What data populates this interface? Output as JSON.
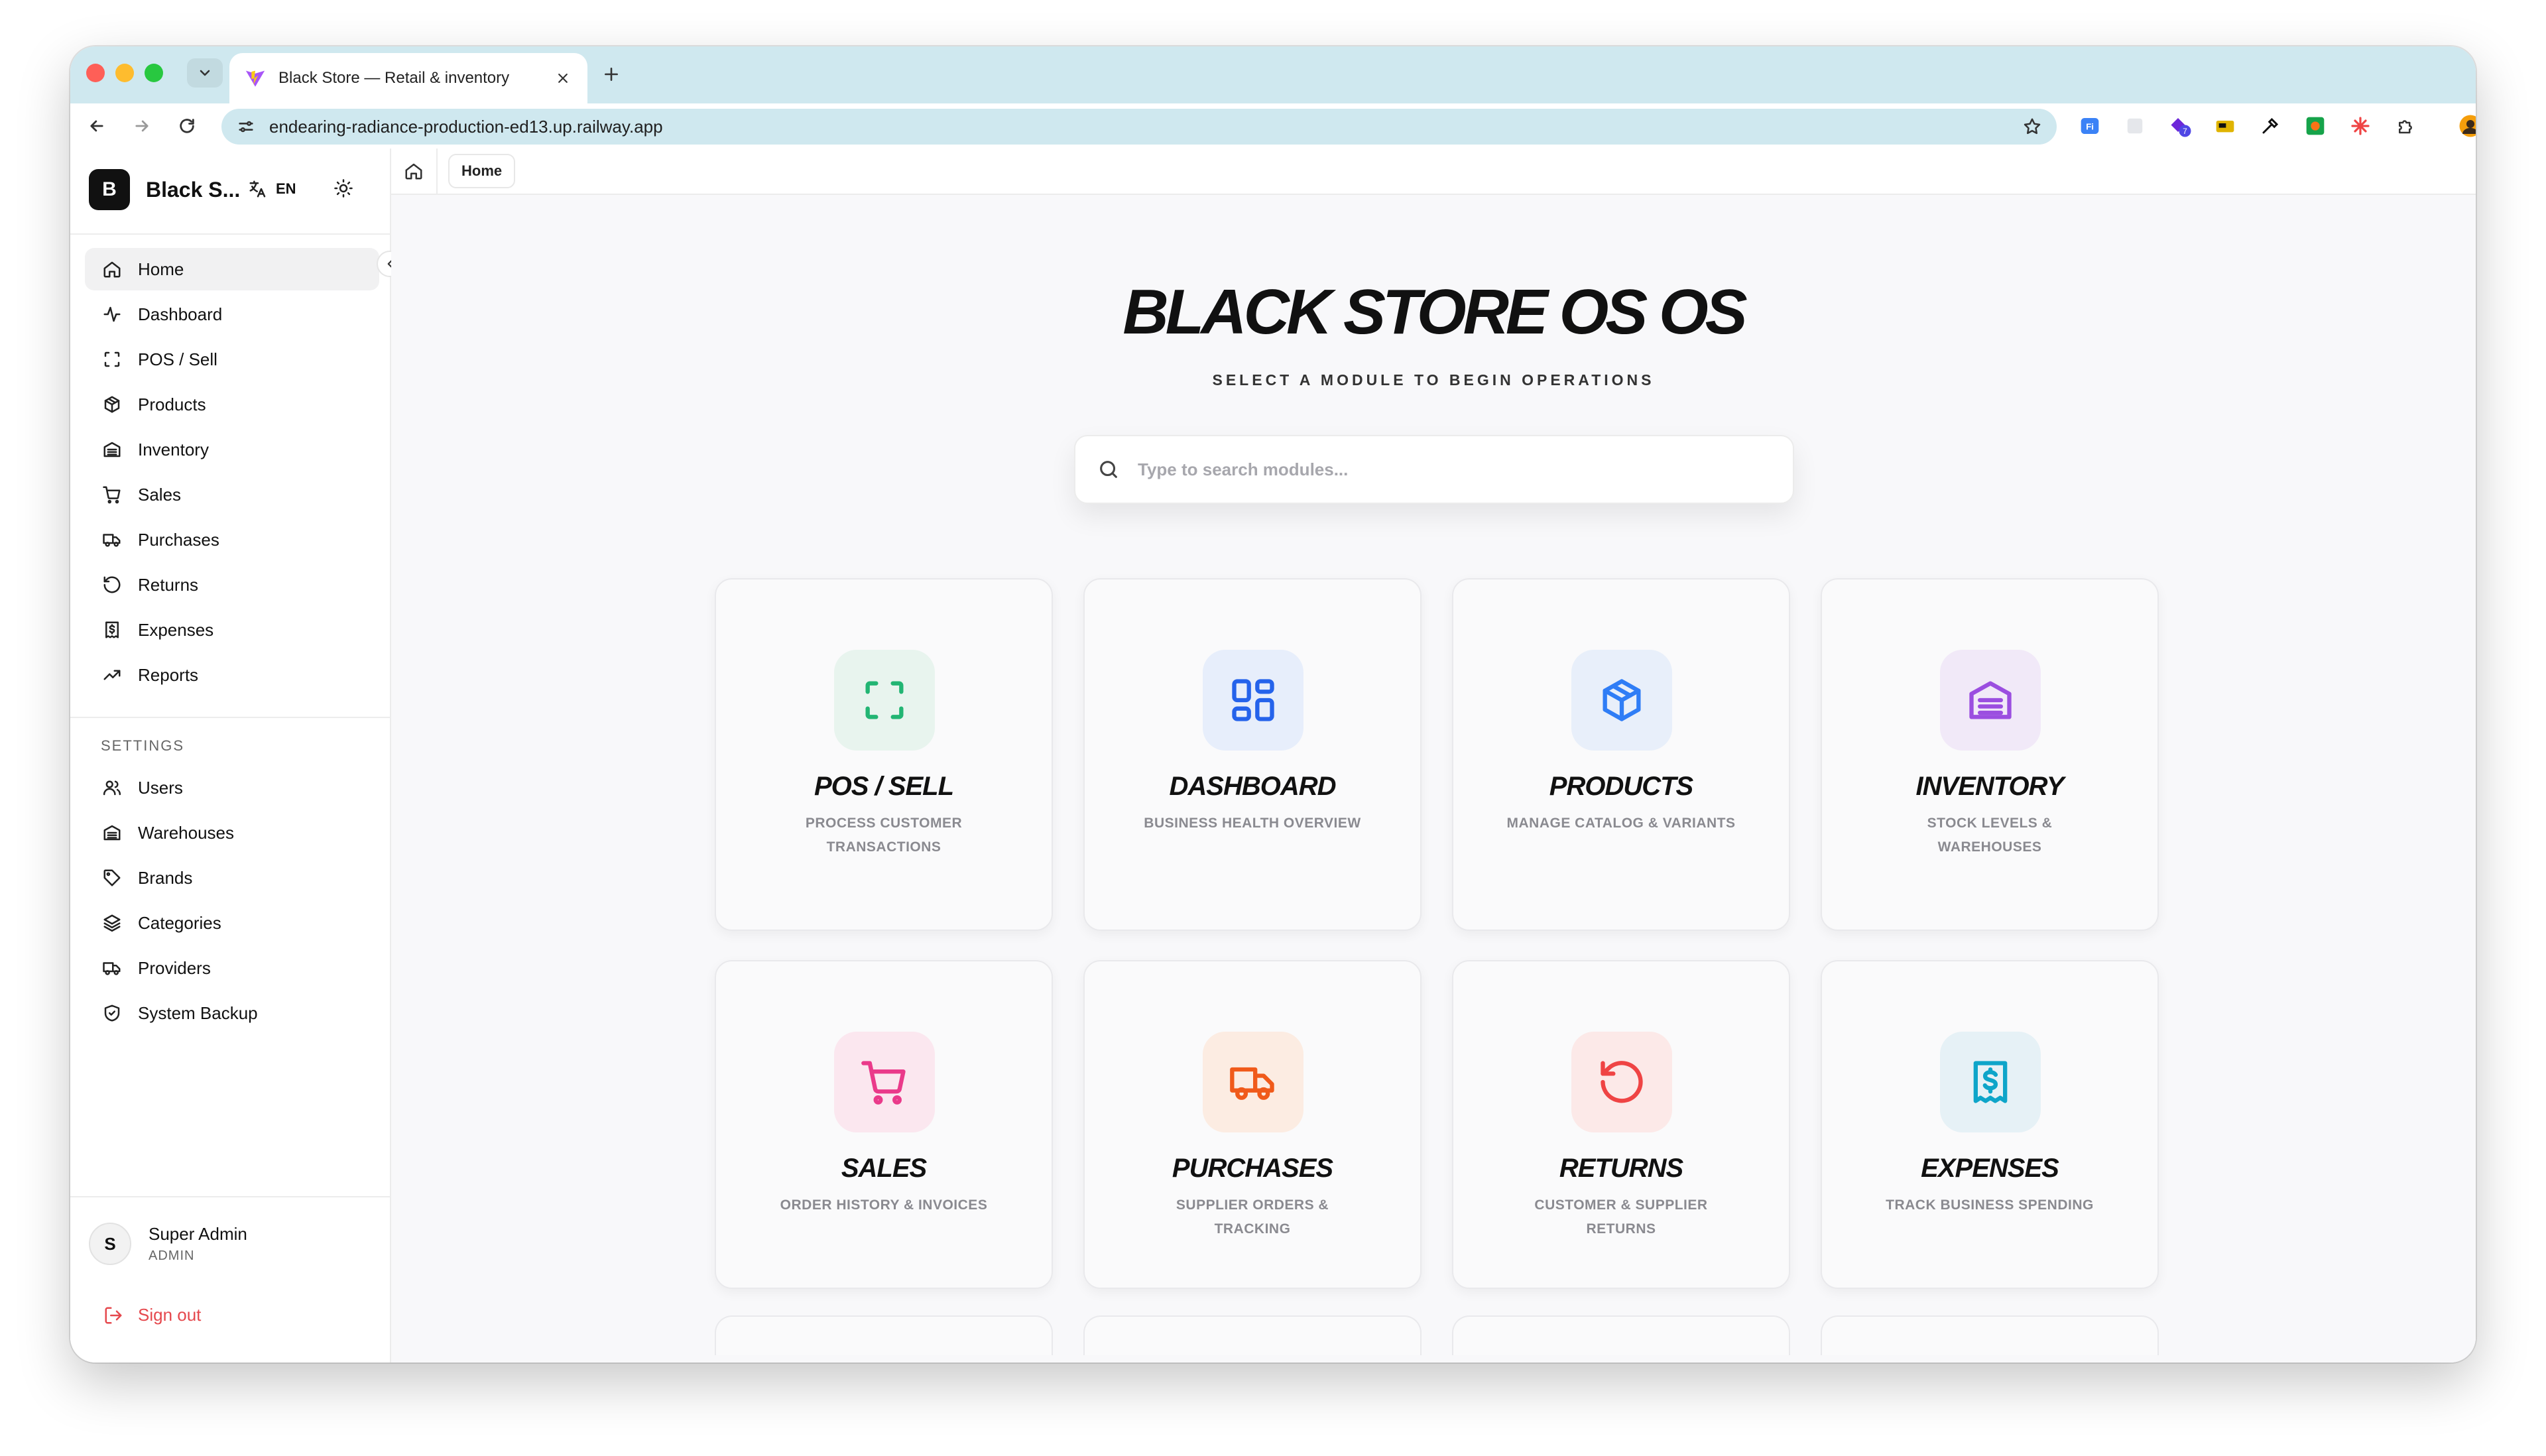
{
  "browser": {
    "tab_title": "Black Store — Retail & inventory",
    "url": "endearing-radiance-production-ed13.up.railway.app"
  },
  "sidebar": {
    "brand_initial": "B",
    "brand_name": "Black S...",
    "language": "EN",
    "items": [
      {
        "label": "Home",
        "icon": "home-icon"
      },
      {
        "label": "Dashboard",
        "icon": "activity-icon"
      },
      {
        "label": "POS / Sell",
        "icon": "scan-icon"
      },
      {
        "label": "Products",
        "icon": "box-icon"
      },
      {
        "label": "Inventory",
        "icon": "warehouse-icon"
      },
      {
        "label": "Sales",
        "icon": "cart-icon"
      },
      {
        "label": "Purchases",
        "icon": "truck-icon"
      },
      {
        "label": "Returns",
        "icon": "rotate-ccw-icon"
      },
      {
        "label": "Expenses",
        "icon": "receipt-icon"
      },
      {
        "label": "Reports",
        "icon": "trending-up-icon"
      }
    ],
    "settings_label": "SETTINGS",
    "settings_items": [
      {
        "label": "Users",
        "icon": "users-icon"
      },
      {
        "label": "Warehouses",
        "icon": "warehouse-icon"
      },
      {
        "label": "Brands",
        "icon": "tag-icon"
      },
      {
        "label": "Categories",
        "icon": "layers-icon"
      },
      {
        "label": "Providers",
        "icon": "truck-icon"
      },
      {
        "label": "System Backup",
        "icon": "shield-icon"
      }
    ],
    "user": {
      "initial": "S",
      "name": "Super Admin",
      "role": "ADMIN"
    },
    "sign_out": "Sign out"
  },
  "breadcrumb": {
    "current": "Home"
  },
  "hero": {
    "title": "BLACK STORE OS OS",
    "subtitle": "SELECT A MODULE TO BEGIN OPERATIONS"
  },
  "search": {
    "placeholder": "Type to search modules...",
    "value": ""
  },
  "modules": [
    {
      "title": "POS / SELL",
      "desc": "PROCESS CUSTOMER TRANSACTIONS",
      "icon": "scan-icon",
      "color": "#22b573",
      "bg": "#e8f4ee"
    },
    {
      "title": "DASHBOARD",
      "desc": "BUSINESS HEALTH OVERVIEW",
      "icon": "layout-grid-icon",
      "color": "#2563eb",
      "bg": "#e7eefb"
    },
    {
      "title": "PRODUCTS",
      "desc": "MANAGE CATALOG & VARIANTS",
      "icon": "box-icon",
      "color": "#2f7df6",
      "bg": "#e8effa"
    },
    {
      "title": "INVENTORY",
      "desc": "STOCK LEVELS & WAREHOUSES",
      "icon": "warehouse-icon",
      "color": "#9b4ee0",
      "bg": "#f1e9f8"
    },
    {
      "title": "SALES",
      "desc": "ORDER HISTORY & INVOICES",
      "icon": "cart-icon",
      "color": "#ea3a8a",
      "bg": "#fbe7ef"
    },
    {
      "title": "PURCHASES",
      "desc": "SUPPLIER ORDERS & TRACKING",
      "icon": "truck-icon",
      "color": "#f05a1a",
      "bg": "#fcece2"
    },
    {
      "title": "RETURNS",
      "desc": "CUSTOMER & SUPPLIER RETURNS",
      "icon": "rotate-ccw-icon",
      "color": "#ef4444",
      "bg": "#fce9e8"
    },
    {
      "title": "EXPENSES",
      "desc": "TRACK BUSINESS SPENDING",
      "icon": "receipt-icon",
      "color": "#0ea5c9",
      "bg": "#e6f1f6"
    }
  ]
}
